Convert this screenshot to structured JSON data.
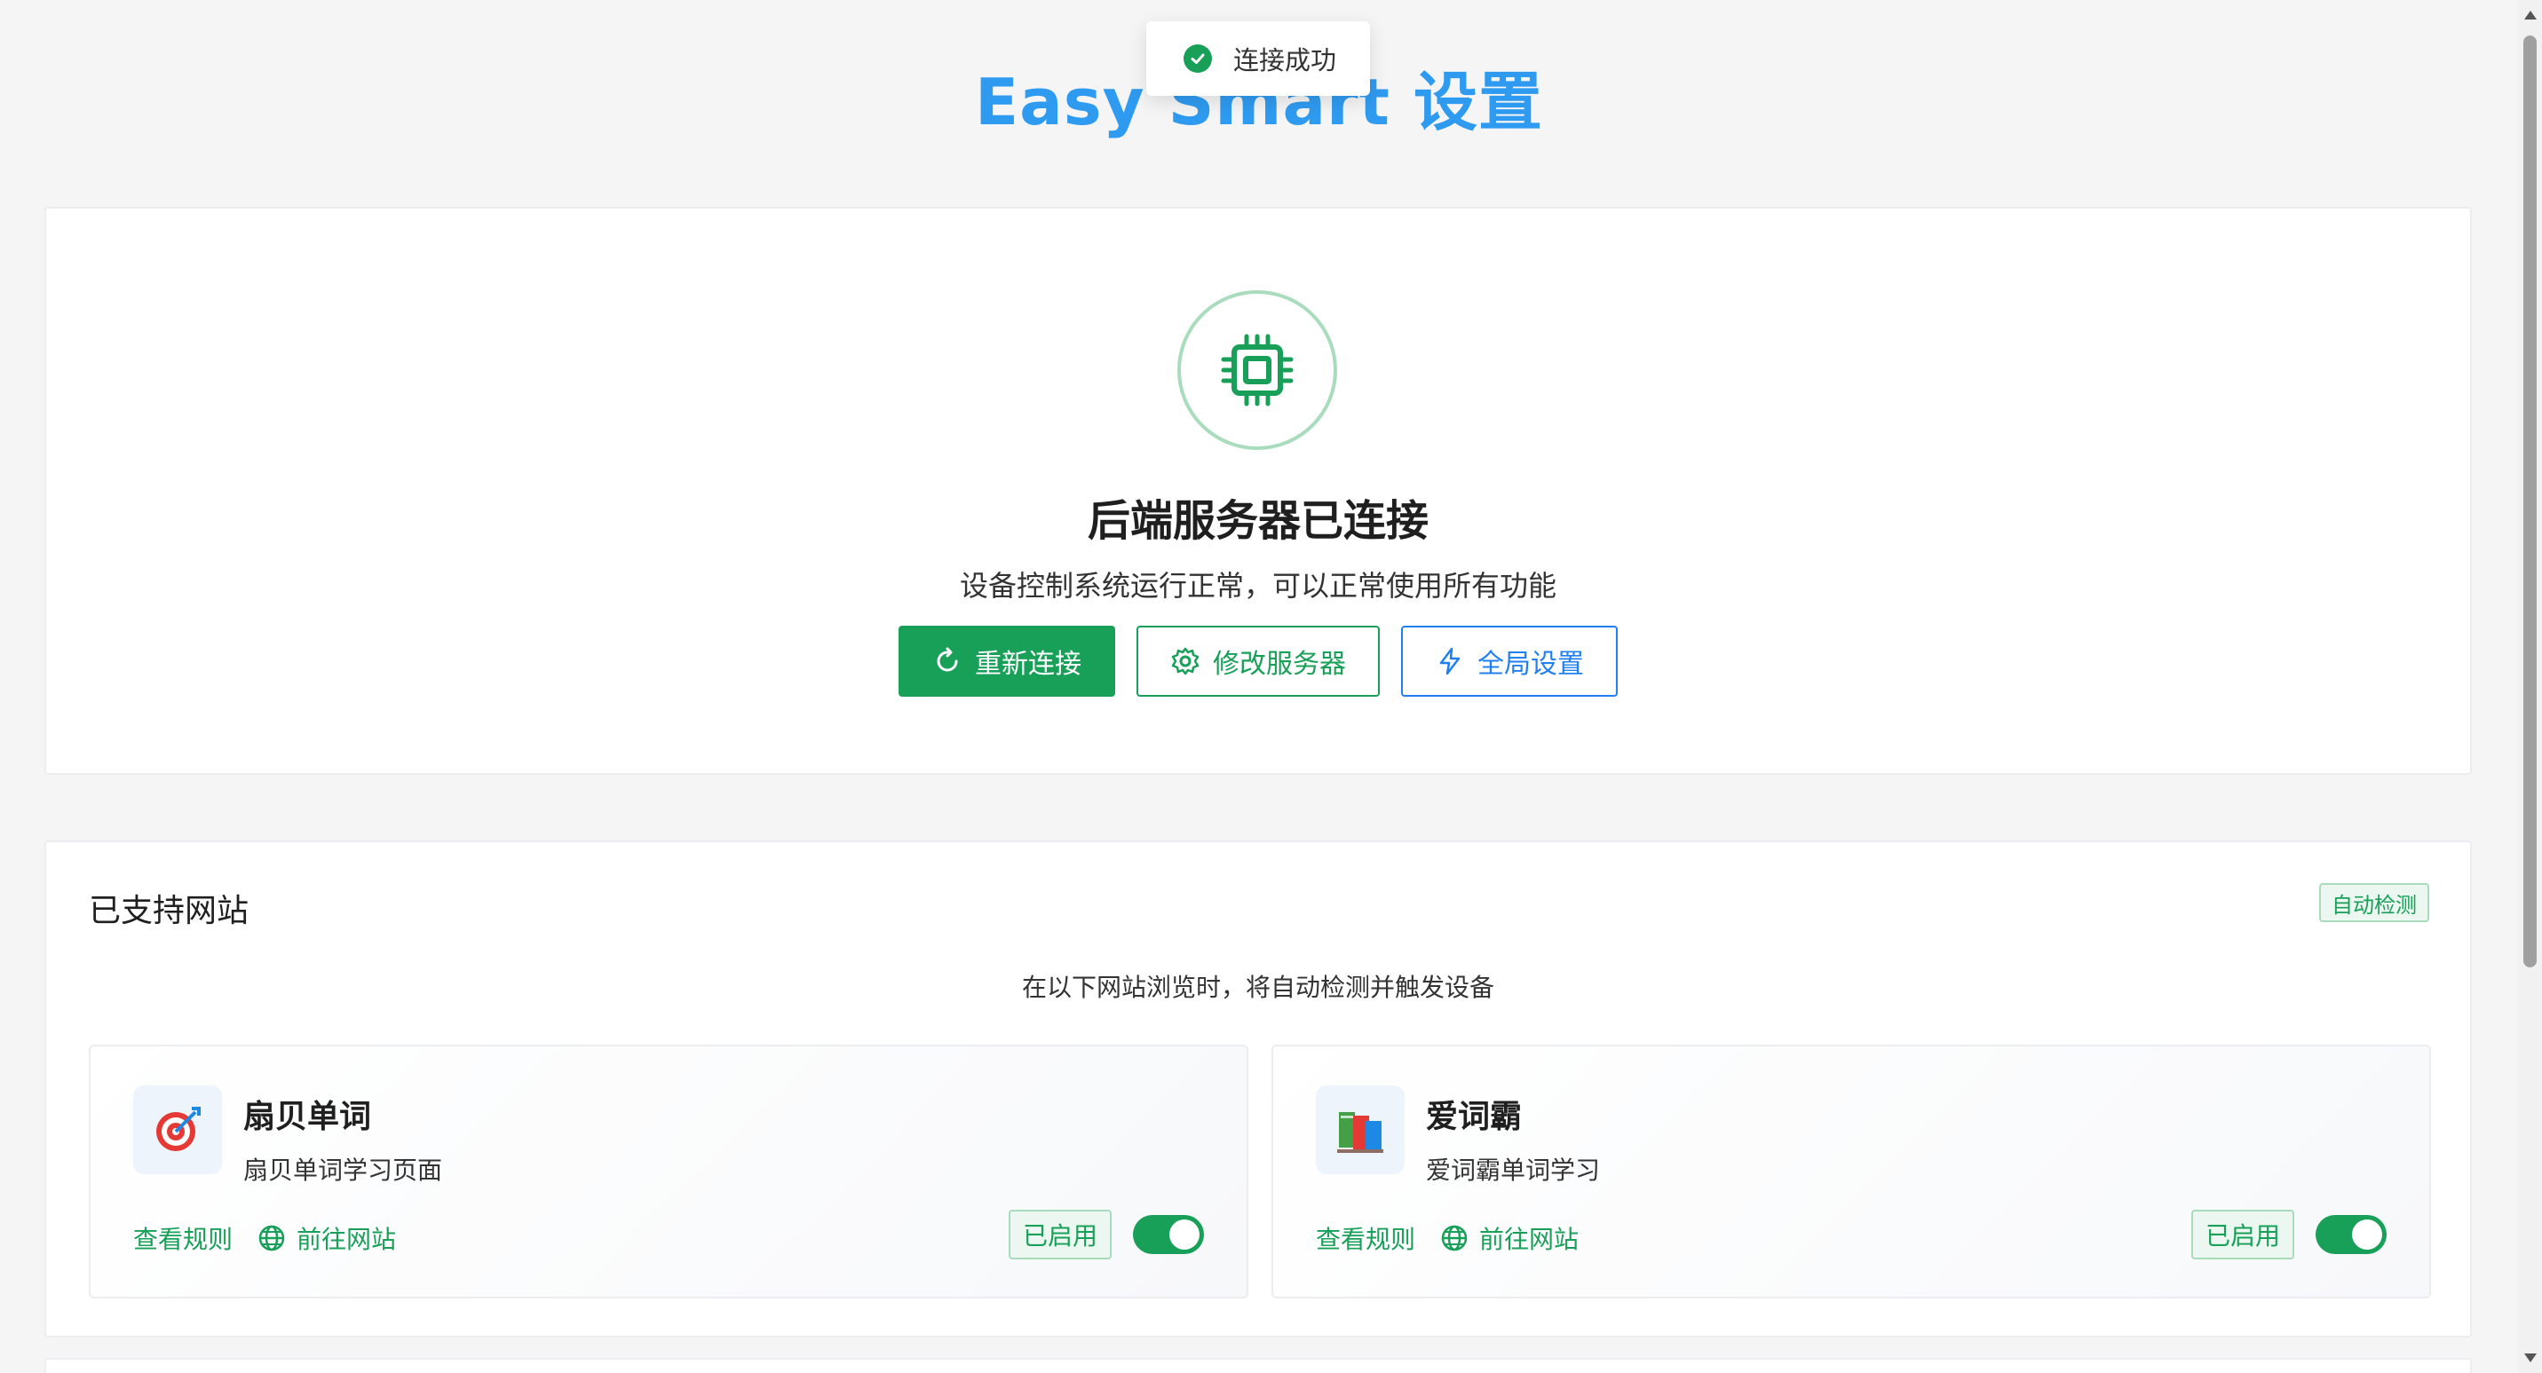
{
  "page_title": "Easy Smart 设置",
  "toast": {
    "message": "连接成功"
  },
  "status": {
    "title": "后端服务器已连接",
    "subtitle": "设备控制系统运行正常，可以正常使用所有功能",
    "buttons": {
      "reconnect": "重新连接",
      "edit_server": "修改服务器",
      "global_settings": "全局设置"
    }
  },
  "sites_section": {
    "title": "已支持网站",
    "tag": "自动检测",
    "description": "在以下网站浏览时，将自动检测并触发设备",
    "sites": [
      {
        "name": "扇贝单词",
        "description": "扇贝单词学习页面",
        "view_rules": "查看规则",
        "go_site": "前往网站",
        "status": "已启用",
        "enabled": true,
        "icon": "target-icon"
      },
      {
        "name": "爱词霸",
        "description": "爱词霸单词学习",
        "view_rules": "查看规则",
        "go_site": "前往网站",
        "status": "已启用",
        "enabled": true,
        "icon": "books-icon"
      }
    ]
  },
  "colors": {
    "primary_green": "#18a058",
    "title_blue": "#2f9bf0",
    "outline_blue": "#2080f0"
  }
}
